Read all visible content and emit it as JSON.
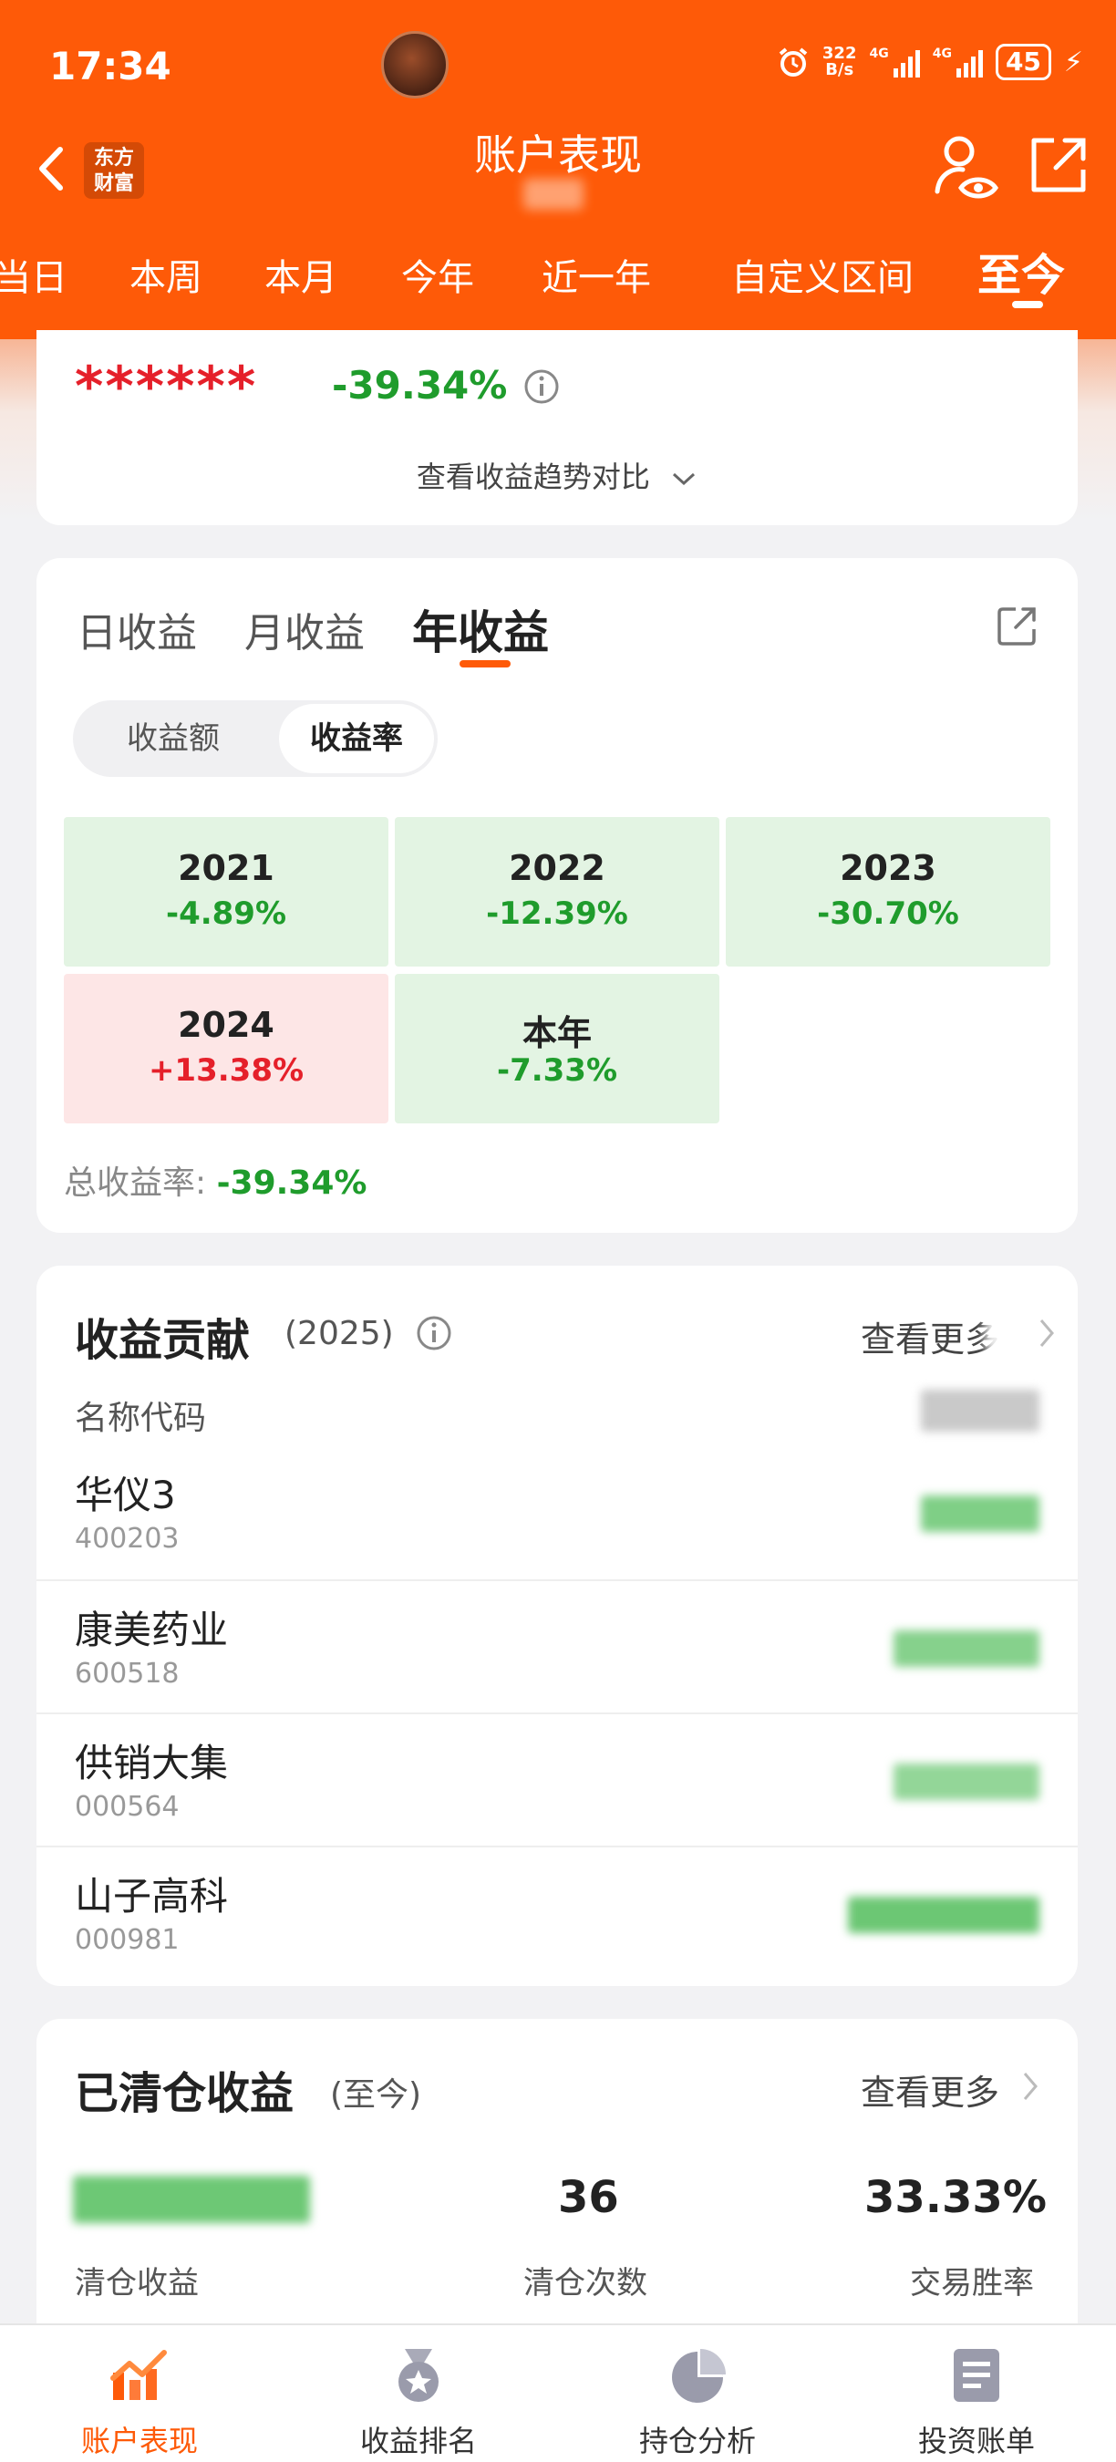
{
  "status_bar": {
    "time": "17:34",
    "net_speed_top": "322",
    "net_speed_bottom": "B/s",
    "signal1_tag": "4G",
    "signal2_tag": "4G",
    "battery": "45"
  },
  "header": {
    "title": "账户表现",
    "logo_line1": "东方",
    "logo_line2": "财富"
  },
  "period_tabs": [
    {
      "label": "当日"
    },
    {
      "label": "本周"
    },
    {
      "label": "本月"
    },
    {
      "label": "今年"
    },
    {
      "label": "近一年"
    },
    {
      "label": "自定义区间"
    },
    {
      "label": "至今",
      "active": true
    }
  ],
  "summary": {
    "masked_name": "******",
    "total_return": "-39.34%",
    "trend_link": "查看收益趋势对比"
  },
  "profit": {
    "tabs": [
      {
        "label": "日收益"
      },
      {
        "label": "月收益"
      },
      {
        "label": "年收益",
        "active": true
      }
    ],
    "toggle": [
      {
        "label": "收益额"
      },
      {
        "label": "收益率",
        "active": true
      }
    ],
    "years": [
      {
        "year": "2021",
        "value": "-4.89%",
        "trend": "down"
      },
      {
        "year": "2022",
        "value": "-12.39%",
        "trend": "down"
      },
      {
        "year": "2023",
        "value": "-30.70%",
        "trend": "down"
      },
      {
        "year": "2024",
        "value": "+13.38%",
        "trend": "up"
      },
      {
        "year": "本年",
        "value": "-7.33%",
        "trend": "down"
      }
    ],
    "total_label": "总收益率: ",
    "total_value": "-39.34%"
  },
  "contribution": {
    "title": "收益贡献",
    "year": "(2025)",
    "more": "查看更多",
    "column_header": "名称代码",
    "stocks": [
      {
        "name": "华仪3",
        "code": "400203"
      },
      {
        "name": "康美药业",
        "code": "600518"
      },
      {
        "name": "供销大集",
        "code": "000564"
      },
      {
        "name": "山子高科",
        "code": "000981"
      }
    ]
  },
  "closed": {
    "title": "已清仓收益",
    "subtitle": "(至今)",
    "more": "查看更多",
    "count_value": "36",
    "count_label": "清仓次数",
    "winrate_value": "33.33%",
    "winrate_label": "交易胜率",
    "profit_label": "清仓收益"
  },
  "bottom_nav": [
    {
      "label": "账户表现",
      "icon": "chart-line-icon",
      "active": true
    },
    {
      "label": "收益排名",
      "icon": "medal-icon"
    },
    {
      "label": "持仓分析",
      "icon": "pie-chart-icon"
    },
    {
      "label": "投资账单",
      "icon": "bill-icon"
    }
  ],
  "colors": {
    "brand": "#fe5a08",
    "up": "#e5202a",
    "down": "#1f9c2c"
  }
}
